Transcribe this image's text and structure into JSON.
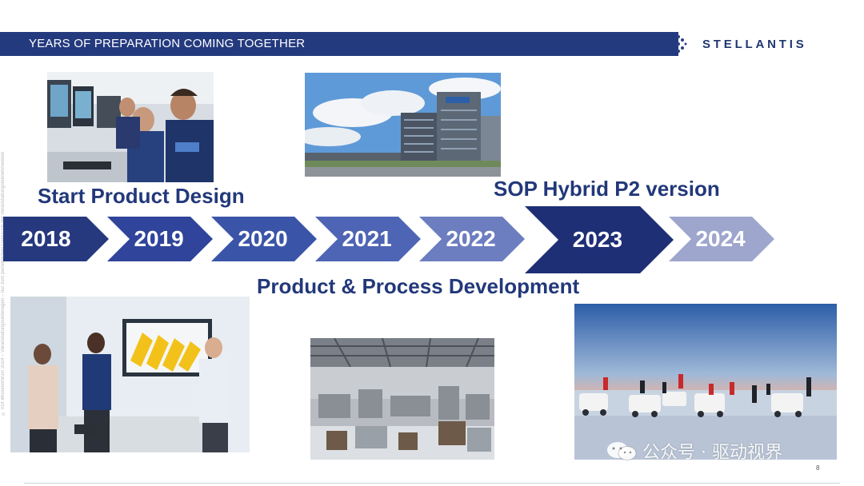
{
  "header": {
    "title": "YEARS OF PREPARATION COMING TOGETHER"
  },
  "logo": {
    "text": "STELLANTIS"
  },
  "side_note": "© VDI Wissensforum 2024 – Veranstaltungsunterlagen – nur zum persönlichen Gebrauch der Veranstaltungsteilnehmenden",
  "labels": {
    "start": "Start Product Design",
    "sop": "SOP Hybrid P2 version",
    "process": "Product & Process Development"
  },
  "timeline": {
    "years": [
      "2018",
      "2019",
      "2020",
      "2021",
      "2022",
      "2023",
      "2024"
    ],
    "highlight": "2023",
    "colors": [
      "#26397f",
      "#2f449a",
      "#3a55a8",
      "#4e64b4",
      "#6c7dc0",
      "#1e2f76",
      "#9ea6ce"
    ]
  },
  "page_number": "8",
  "watermark": {
    "text": "公众号 · 驱动视界"
  }
}
